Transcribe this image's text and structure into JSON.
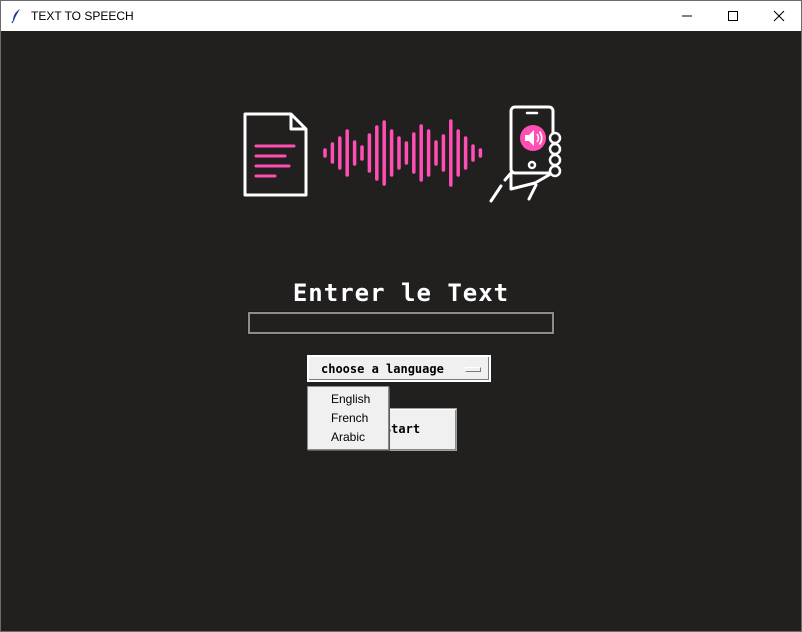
{
  "window": {
    "title": "TEXT TO SPEECH",
    "controls": [
      "minimize-icon",
      "maximize-icon",
      "close-icon"
    ]
  },
  "banner": {
    "icons": [
      "document-icon",
      "sound-wave-icon",
      "phone-speaker-icon"
    ],
    "accent_color": "#ff4fb4",
    "line_color": "#ffffff"
  },
  "form": {
    "prompt_label": "Entrer le Text",
    "text_input_value": "",
    "language_button_label": "choose a language",
    "language_options": [
      "English",
      "French",
      "Arabic"
    ],
    "start_button_label": "Start"
  },
  "colors": {
    "background": "#221f1f",
    "button_face": "#f0f0f0"
  }
}
